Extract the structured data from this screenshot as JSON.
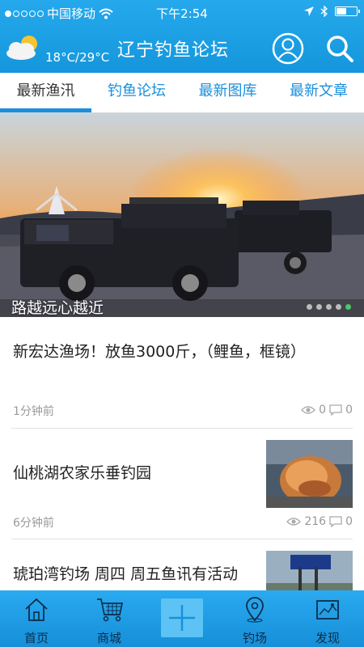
{
  "status": {
    "carrier": "中国移动",
    "time": "下午2:54"
  },
  "header": {
    "temperature": "18°C/29°C",
    "title": "辽宁钓鱼论坛",
    "weather_icon": "partly-cloudy-icon"
  },
  "tabs": [
    {
      "label": "最新渔汛",
      "active": true
    },
    {
      "label": "钓鱼论坛",
      "active": false
    },
    {
      "label": "最新图库",
      "active": false
    },
    {
      "label": "最新文章",
      "active": false
    }
  ],
  "banner": {
    "caption": "路越远心越近",
    "page_count": 5,
    "active_page": 4
  },
  "news": [
    {
      "title": "新宏达渔场！放鱼3000斤，（鲤鱼，框镜）",
      "time": "1分钟前",
      "views": "0",
      "comments": "0"
    },
    {
      "title": "仙桃湖农家乐垂钓园",
      "time": "6分钟前",
      "views": "216",
      "comments": "0"
    },
    {
      "title": "琥珀湾钓场 周四 周五鱼讯有活动"
    }
  ],
  "tabbar": {
    "home": "首页",
    "shop": "商城",
    "spots": "钓场",
    "discover": "发现"
  },
  "colors": {
    "primary": "#1a8fdc",
    "header_bg": "#1596dc",
    "pager_active": "#4ec46a"
  }
}
